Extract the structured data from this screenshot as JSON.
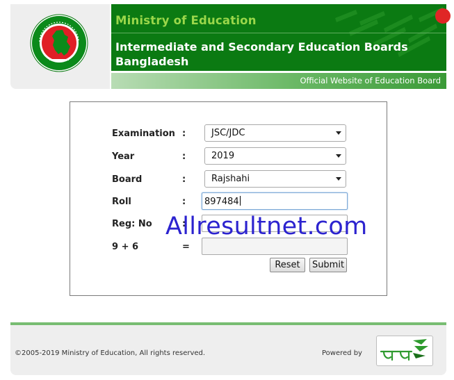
{
  "header": {
    "ministry_title": "Ministry of Education",
    "boards_title": "Intermediate and Secondary Education Boards Bangladesh",
    "subbar_text": "Official Website of Education Board"
  },
  "form": {
    "rows": [
      {
        "label": "Examination",
        "colon": ":",
        "type": "select",
        "value": "JSC/JDC"
      },
      {
        "label": "Year",
        "colon": ":",
        "type": "select",
        "value": "2019"
      },
      {
        "label": "Board",
        "colon": ":",
        "type": "select",
        "value": "Rajshahi"
      },
      {
        "label": "Roll",
        "colon": ":",
        "type": "input",
        "value": "897484"
      },
      {
        "label": "Reg: No",
        "colon": ":",
        "type": "input",
        "value": ""
      },
      {
        "label": "9 + 6",
        "colon": "=",
        "type": "input",
        "value": ""
      }
    ],
    "reset_label": "Reset",
    "submit_label": "Submit"
  },
  "watermark": "Allresultnet.com",
  "footer": {
    "copyright": "©2005-2019 Ministry of Education, All rights reserved.",
    "powered_by": "Powered by"
  },
  "colors": {
    "header_green": "#0b7a12",
    "ministry_green": "#9ad74a",
    "footer_line": "#78bd72",
    "watermark_blue": "#2c23cf"
  }
}
